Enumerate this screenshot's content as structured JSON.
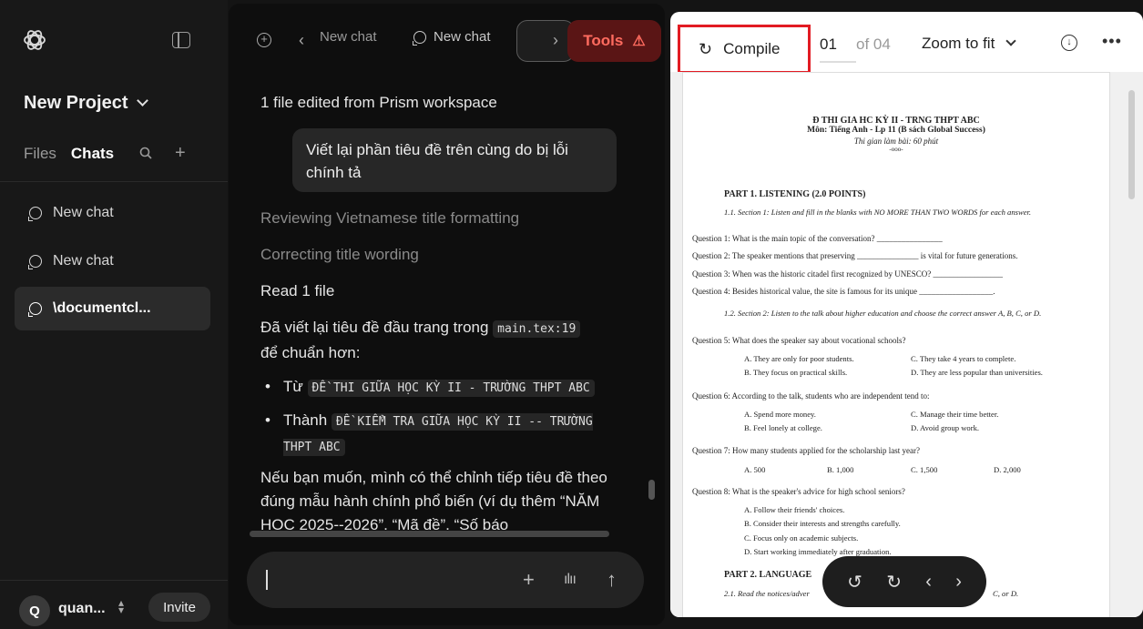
{
  "sidebar": {
    "project_title": "New Project",
    "tabs": [
      "Files",
      "Chats"
    ],
    "chats": [
      "New chat",
      "New chat",
      "\\documentcl..."
    ],
    "user_initial": "Q",
    "user_name": "quan...",
    "invite_label": "Invite"
  },
  "tabbar": {
    "tab1": "New chat",
    "tab2": "New chat",
    "tools_label": "Tools"
  },
  "chat": {
    "status": "1 file edited from Prism workspace",
    "user_message": "Viết lại phần tiêu đề trên cùng do bị lỗi chính tả",
    "step1": "Reviewing Vietnamese title formatting",
    "step2": "Correcting title wording",
    "step3": "Read 1 file",
    "answer_intro_1": "Đã viết lại tiêu đề đầu trang trong",
    "answer_code": "main.tex:19",
    "answer_intro_2": "để chuẩn hơn:",
    "bullet1_prefix": "Từ",
    "bullet1_code": "ĐỀ THI GIỮA HỌC KỲ II - TRƯỜNG THPT ABC",
    "bullet2_prefix": "Thành",
    "bullet2_code": "ĐỀ KIỂM TRA GIỮA HỌC KỲ II -- TRƯỜNG THPT ABC",
    "tail": "Nếu bạn muốn, mình có thể chỉnh tiếp tiêu đề theo đúng mẫu hành chính phổ biến (ví dụ thêm “NĂM HỌC 2025--2026”, “Mã đề”, “Số báo"
  },
  "pdf_toolbar": {
    "compile_label": "Compile",
    "page_current": "01",
    "page_total": "of 04",
    "zoom_label": "Zoom to fit"
  },
  "pdf": {
    "title": "Đ THI GIA HC KỲ II - TRNG THPT ABC",
    "subject": "Môn: Tiếng Anh - Lp 11 (B sách Global Success)",
    "time": "Thi gian làm bài: 60 phút",
    "sep": "-ooo-",
    "part1": "PART 1.  LISTENING (2.0 POINTS)",
    "sec11": "1.1. Section 1: Listen and fill in the blanks with NO MORE THAN TWO WORDS for each answer.",
    "q1": "Question 1:  What is the main topic of the conversation? ________________",
    "q2": "Question 2:  The speaker mentions that preserving _______________ is vital for future generations.",
    "q3": "Question 3:  When was the historic citadel first recognized by UNESCO? _________________",
    "q4": "Question 4:  Besides historical value, the site is famous for its unique __________________.",
    "sec12": "1.2. Section 2: Listen to the talk about higher education and choose the correct answer A, B, C, or D.",
    "q5": "Question 5:  What does the speaker say about vocational schools?",
    "q5a": "A. They are only for poor students.",
    "q5c": "C. They take 4 years to complete.",
    "q5b": "B. They focus on practical skills.",
    "q5d": "D. They are less popular than universities.",
    "q6": "Question 6:  According to the talk, students who are independent tend to:",
    "q6a": "A. Spend more money.",
    "q6c": "C. Manage their time better.",
    "q6b": "B. Feel lonely at college.",
    "q6d": "D. Avoid group work.",
    "q7": "Question 7:  How many students applied for the scholarship last year?",
    "q7a": "A. 500",
    "q7b": "B. 1,000",
    "q7c": "C. 1,500",
    "q7d": "D. 2,000",
    "q8": "Question 8:  What is the speaker's advice for high school seniors?",
    "q8a": "A. Follow their friends' choices.",
    "q8b": "B. Consider their interests and strengths carefully.",
    "q8c": "C. Focus only on academic subjects.",
    "q8d": "D. Start working immediately after graduation.",
    "part2": "PART 2.  LANGUAGE",
    "sec21": "2.1. Read the notices/adver",
    "sec21_end": "C, or D."
  }
}
